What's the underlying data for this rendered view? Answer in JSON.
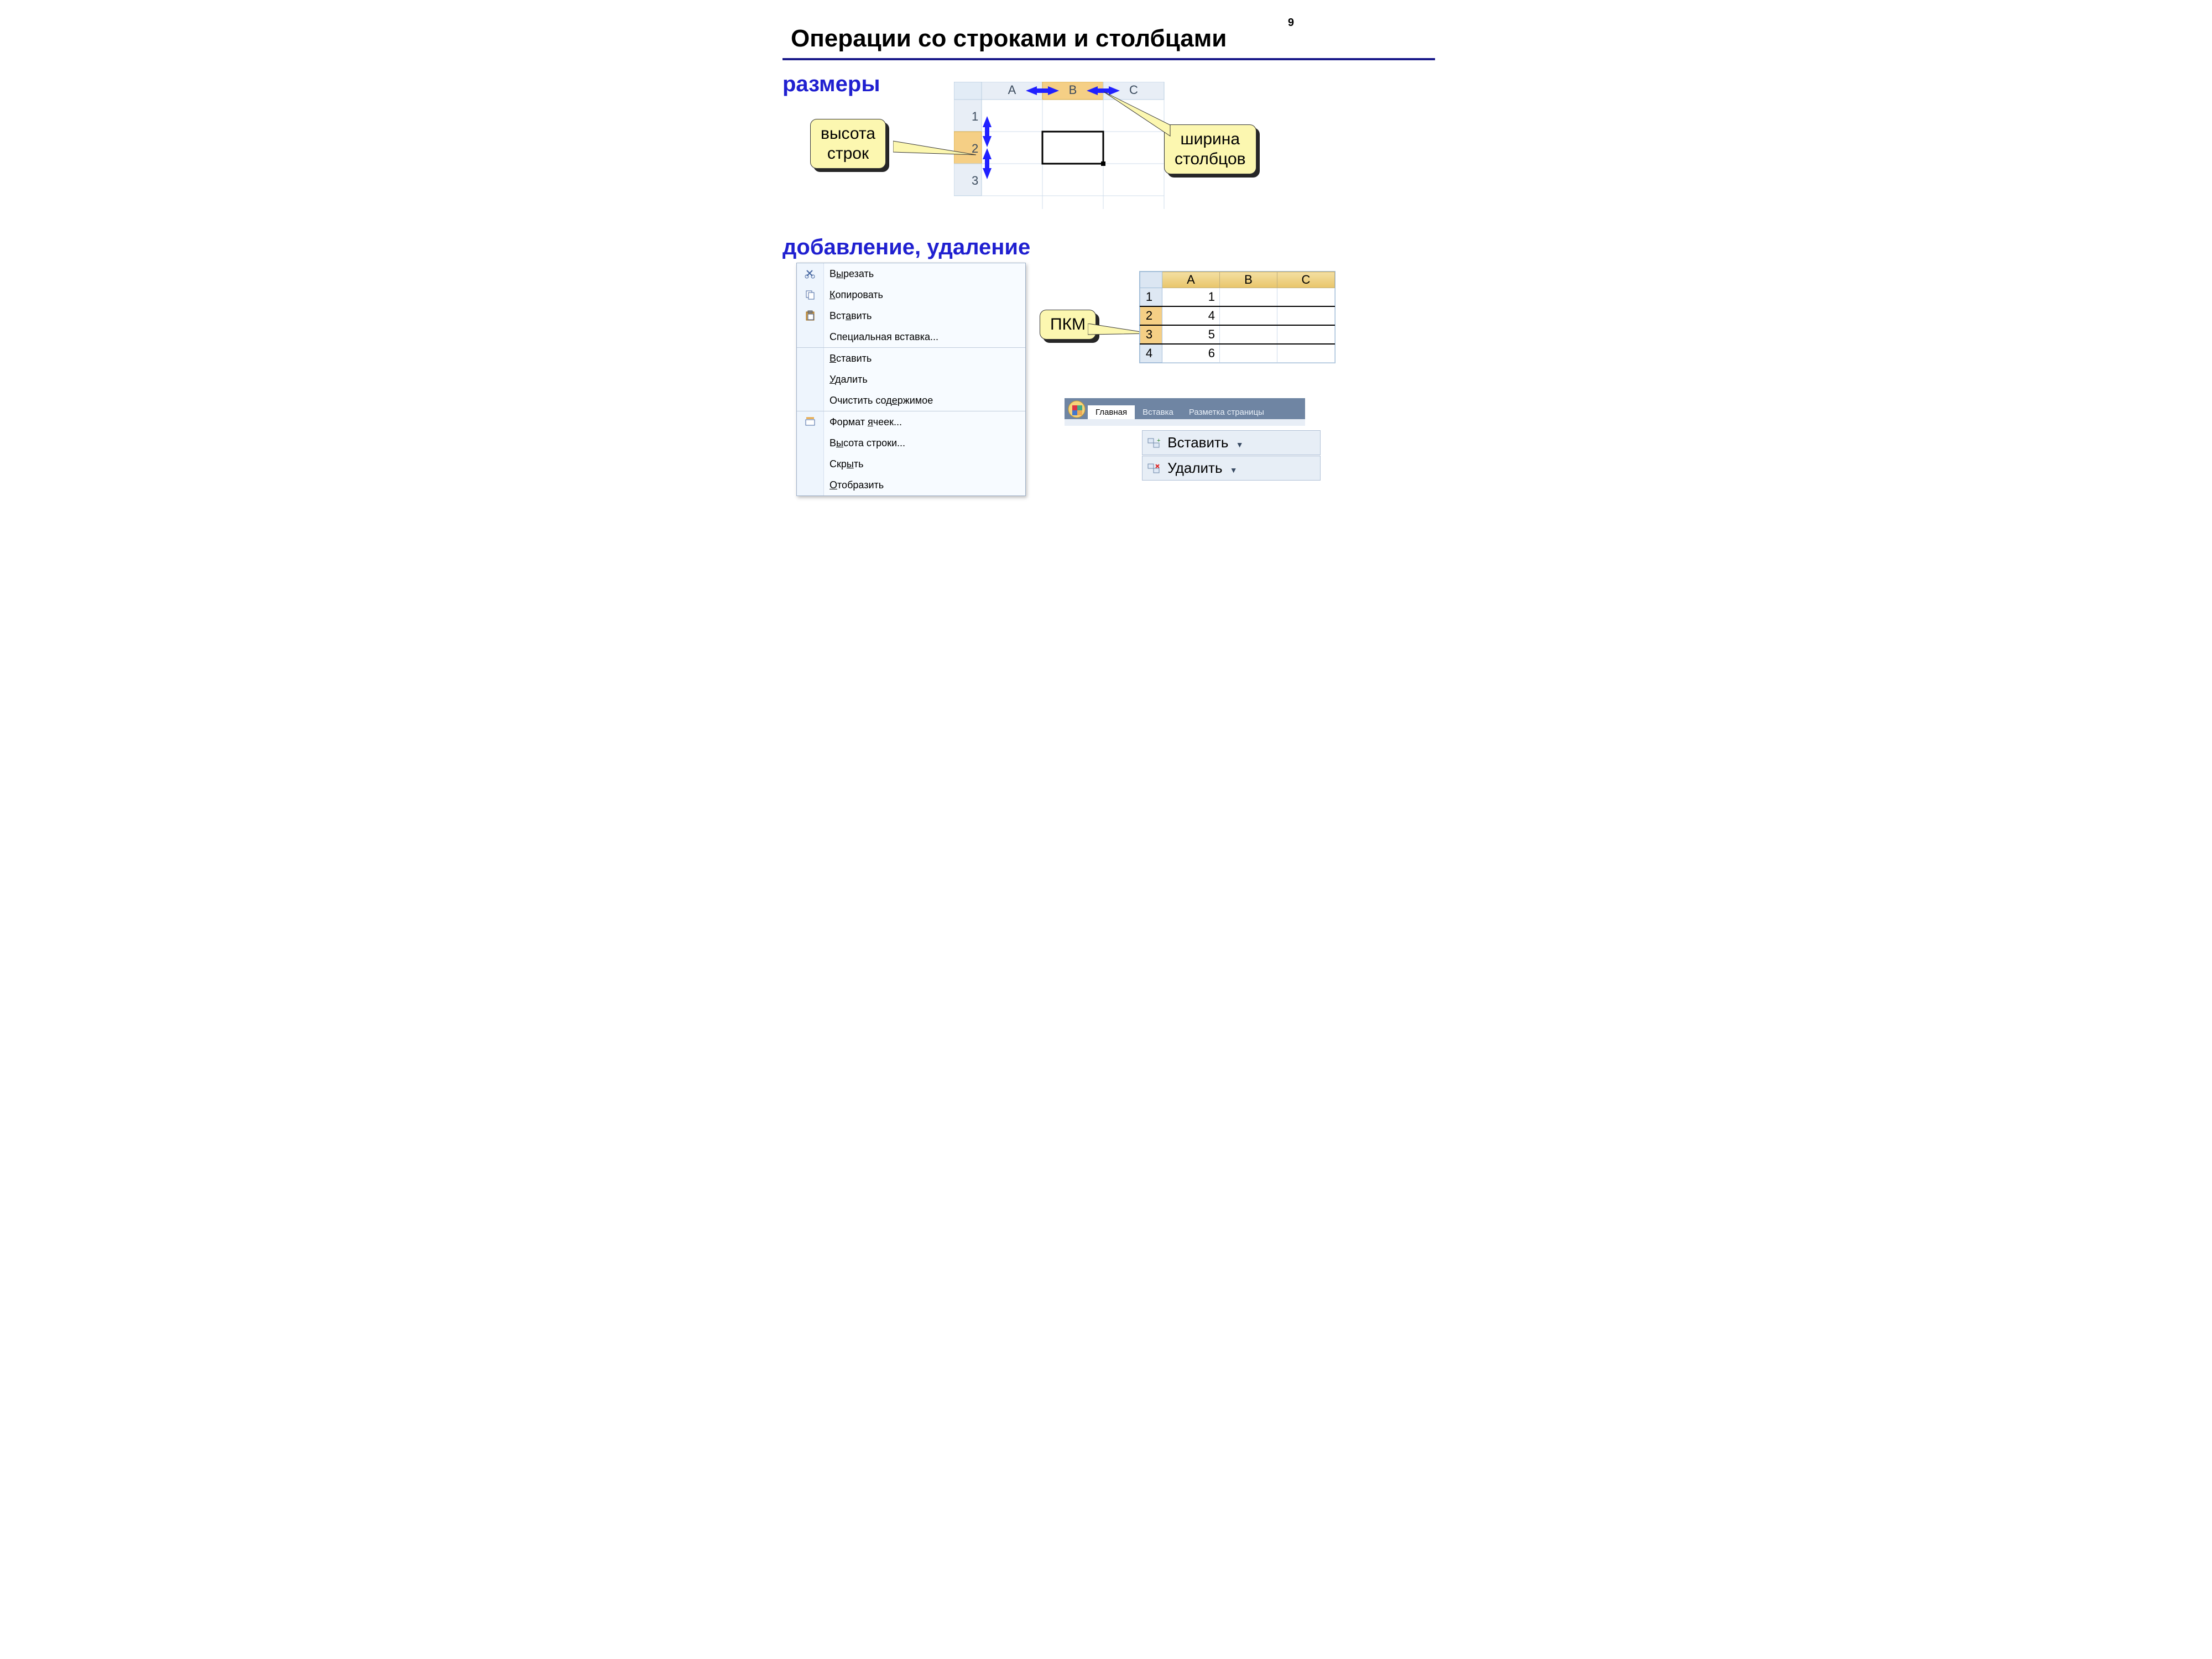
{
  "page_number": "9",
  "title": "Операции со строками и столбцами",
  "subheadings": {
    "sizes": "размеры",
    "add_del": "добавление, удаление"
  },
  "callouts": {
    "row_height": "высота\nстрок",
    "col_width": "ширина\nстолбцов",
    "right_click": "ПКМ"
  },
  "size_grid": {
    "cols": [
      "A",
      "B",
      "C"
    ],
    "rows": [
      "1",
      "2",
      "3"
    ],
    "selected_cell": "B2"
  },
  "context_menu": [
    {
      "icon": "cut",
      "label": "Вырезать",
      "u": 1
    },
    {
      "icon": "copy",
      "label": "Копировать",
      "u": 0
    },
    {
      "icon": "paste",
      "label": "Вставить",
      "u": 3
    },
    {
      "icon": "",
      "label": "Специальная вставка...",
      "u": -1,
      "sep": false
    },
    {
      "icon": "",
      "label": "Вставить",
      "u": 0,
      "sep": true
    },
    {
      "icon": "",
      "label": "Удалить",
      "u": 0
    },
    {
      "icon": "",
      "label": "Очистить содержимое",
      "u": 12,
      "sep": false
    },
    {
      "icon": "format",
      "label": "Формат ячеек...",
      "u": 7,
      "sep": true
    },
    {
      "icon": "",
      "label": "Высота строки...",
      "u": 1
    },
    {
      "icon": "",
      "label": "Скрыть",
      "u": 3
    },
    {
      "icon": "",
      "label": "Отобразить",
      "u": 0
    }
  ],
  "data_grid": {
    "cols": [
      "A",
      "B",
      "C"
    ],
    "rows": [
      {
        "n": "1",
        "a": "1"
      },
      {
        "n": "2",
        "a": "4",
        "sel": true
      },
      {
        "n": "3",
        "a": "5",
        "sel": true
      },
      {
        "n": "4",
        "a": "6"
      }
    ]
  },
  "ribbon": {
    "tabs": [
      "Главная",
      "Вставка",
      "Разметка страницы"
    ],
    "active_tab": 0,
    "buttons": {
      "insert": "Вставить",
      "delete": "Удалить"
    }
  }
}
